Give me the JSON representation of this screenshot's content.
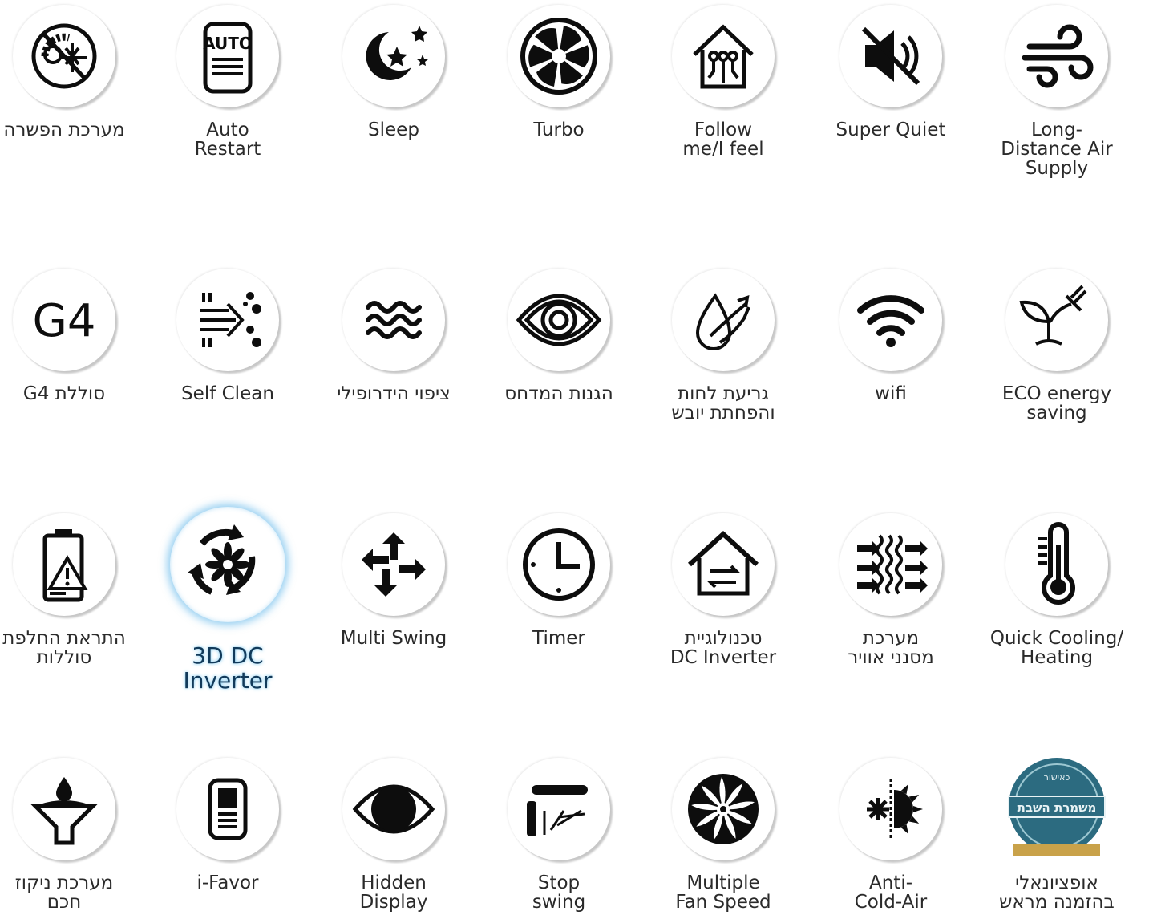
{
  "features": [
    {
      "icon": "defrost-icon",
      "lines": [
        "מערכת הפשרה"
      ],
      "rtl": true
    },
    {
      "icon": "auto-restart-icon",
      "lines": [
        "Auto",
        "Restart"
      ],
      "icon_text": "AUTO"
    },
    {
      "icon": "sleep-icon",
      "lines": [
        "Sleep"
      ]
    },
    {
      "icon": "turbo-fan-icon",
      "lines": [
        "Turbo"
      ]
    },
    {
      "icon": "follow-me-house-icon",
      "lines": [
        "Follow",
        "me/I feel"
      ]
    },
    {
      "icon": "mute-speaker-icon",
      "lines": [
        "Super Quiet"
      ]
    },
    {
      "icon": "wind-icon",
      "lines": [
        "Long-",
        "Distance Air",
        "Supply"
      ]
    },
    {
      "icon": "g4-filter-icon",
      "lines": [
        "סוללת  G4"
      ],
      "rtl": true,
      "icon_text": "G4"
    },
    {
      "icon": "self-clean-icon",
      "lines": [
        "Self Clean"
      ]
    },
    {
      "icon": "hydrophilic-waves-icon",
      "lines": [
        "ציפוי הידרופילי"
      ],
      "rtl": true
    },
    {
      "icon": "compressor-protection-icon",
      "lines": [
        "הגנות המדחס"
      ],
      "rtl": true
    },
    {
      "icon": "dehumidify-icon",
      "lines": [
        "גריעת לחות",
        "והפחתת יובש"
      ],
      "rtl": true
    },
    {
      "icon": "wifi-icon",
      "lines": [
        "wifi"
      ]
    },
    {
      "icon": "eco-plant-plug-icon",
      "lines": [
        "ECO energy",
        "saving"
      ]
    },
    {
      "icon": "battery-warning-icon",
      "lines": [
        "התראת החלפת",
        "סוללות"
      ],
      "rtl": true
    },
    {
      "icon": "3d-dc-inverter-icon",
      "lines": [
        "3D DC",
        "Inverter"
      ],
      "highlight": true
    },
    {
      "icon": "multi-swing-arrows-icon",
      "lines": [
        "Multi Swing"
      ]
    },
    {
      "icon": "timer-clock-icon",
      "lines": [
        "Timer"
      ]
    },
    {
      "icon": "dc-inverter-house-icon",
      "lines": [
        "טכנולוגיית",
        "DC Inverter"
      ],
      "rtl": true
    },
    {
      "icon": "air-filter-icon",
      "lines": [
        "מערכת",
        "מסנני אוויר"
      ],
      "rtl": true
    },
    {
      "icon": "thermometer-icon",
      "lines": [
        "Quick Cooling/",
        "Heating"
      ]
    },
    {
      "icon": "drain-funnel-icon",
      "lines": [
        "מערכת ניקוז",
        "חכם"
      ],
      "rtl": true
    },
    {
      "icon": "remote-control-icon",
      "lines": [
        "i-Favor"
      ]
    },
    {
      "icon": "hidden-display-eye-icon",
      "lines": [
        "Hidden",
        "Display"
      ]
    },
    {
      "icon": "stop-swing-icon",
      "lines": [
        "Stop",
        "swing"
      ]
    },
    {
      "icon": "multi-fan-speed-icon",
      "lines": [
        "Multiple",
        "Fan Speed"
      ]
    },
    {
      "icon": "anti-cold-air-icon",
      "lines": [
        "Anti-",
        "Cold-Air"
      ]
    },
    {
      "icon": "shabbat-kosher-seal-icon",
      "lines": [
        "אופציונאלי",
        "בהזמנה מראש"
      ],
      "rtl": true,
      "seal_text": [
        "כאישור",
        "משמרת השבת"
      ]
    }
  ],
  "colors": {
    "icon": "#0d0d0d",
    "seal": "#2c6b80",
    "seal_gold": "#c9a24a",
    "glow": "#46aae6"
  }
}
